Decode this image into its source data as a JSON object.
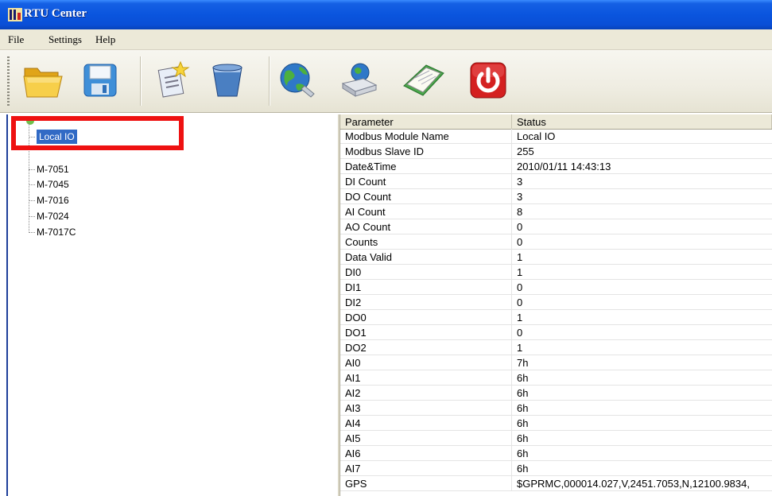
{
  "window": {
    "title": "RTU Center"
  },
  "menu": [
    "File",
    "Settings",
    "Help"
  ],
  "toolbar": {
    "buttons": [
      "open-folder-icon",
      "save-disk-icon",
      "new-document-icon",
      "recycle-bin-icon",
      "network-globe-icon",
      "modem-device-icon",
      "notebook-icon",
      "power-exit-icon"
    ],
    "colors": {
      "power": "#d42020",
      "folder": "#f2c23a",
      "notebook": "#4aa84a"
    }
  },
  "tree": {
    "items": [
      "Local IO",
      "M-7051",
      "M-7045",
      "M-7016",
      "M-7024",
      "M-7017C"
    ],
    "selected_color": "#316ac5",
    "highlight_color": "#ee1111"
  },
  "grid": {
    "headers": [
      "Parameter",
      "Status"
    ],
    "rows": [
      [
        "Modbus Module Name",
        "Local IO"
      ],
      [
        "Modbus Slave ID",
        "255"
      ],
      [
        "Date&Time",
        "2010/01/11  14:43:13"
      ],
      [
        "DI Count",
        "3"
      ],
      [
        "DO Count",
        "3"
      ],
      [
        "AI Count",
        "8"
      ],
      [
        "AO Count",
        "0"
      ],
      [
        "Counts",
        "0"
      ],
      [
        "Data Valid",
        "1"
      ],
      [
        "DI0",
        "1"
      ],
      [
        "DI1",
        "0"
      ],
      [
        "DI2",
        "0"
      ],
      [
        "DO0",
        "1"
      ],
      [
        "DO1",
        "0"
      ],
      [
        "DO2",
        "1"
      ],
      [
        "AI0",
        "7h"
      ],
      [
        "AI1",
        "6h"
      ],
      [
        "AI2",
        "6h"
      ],
      [
        "AI3",
        "6h"
      ],
      [
        "AI4",
        "6h"
      ],
      [
        "AI5",
        "6h"
      ],
      [
        "AI6",
        "6h"
      ],
      [
        "AI7",
        "6h"
      ],
      [
        "GPS",
        "$GPRMC,000014.027,V,2451.7053,N,12100.9834,"
      ]
    ]
  }
}
